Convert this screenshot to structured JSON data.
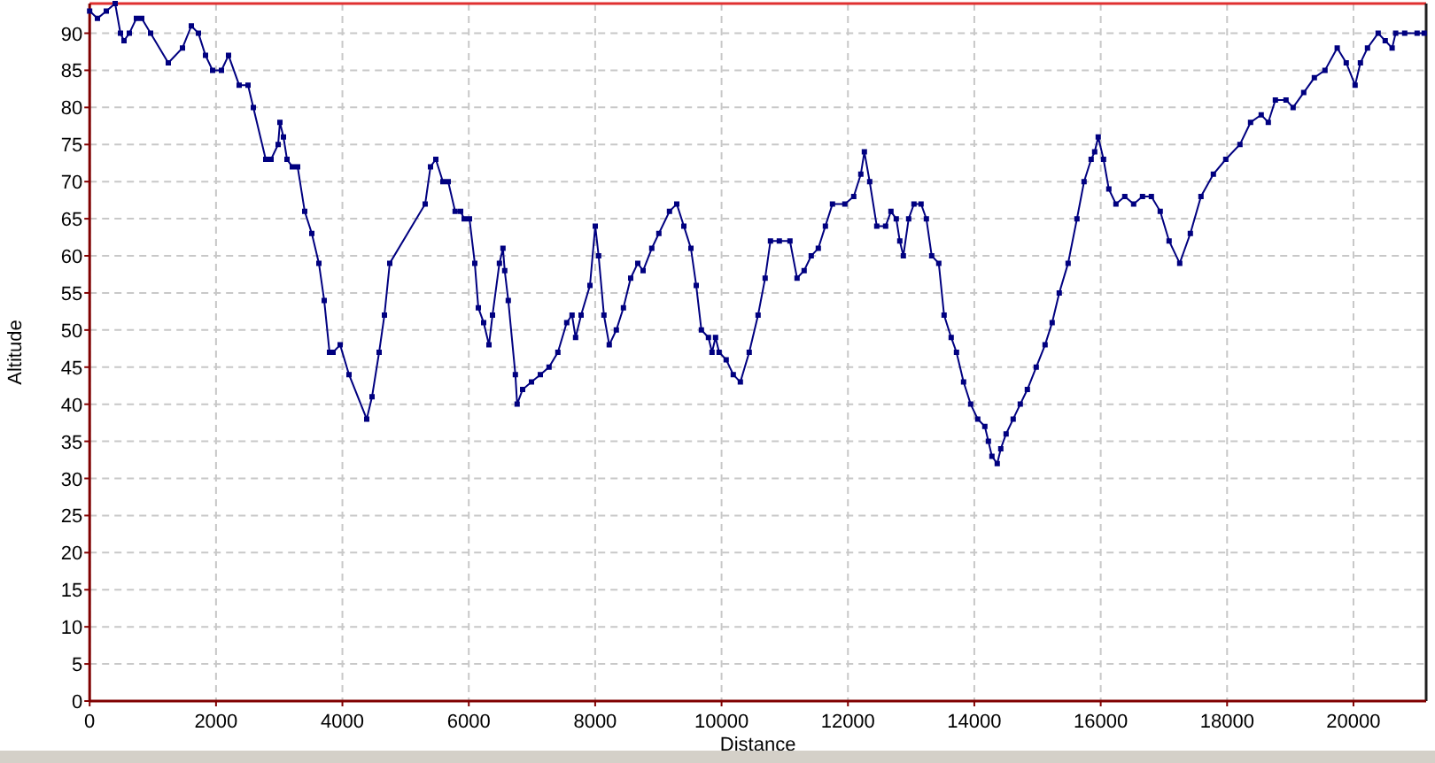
{
  "chart_data": {
    "type": "line",
    "xlabel": "Distance",
    "ylabel": "Altitude",
    "xlim": [
      0,
      21150
    ],
    "ylim": [
      0,
      94
    ],
    "grid": true,
    "xticks": [
      0,
      2000,
      4000,
      6000,
      8000,
      10000,
      12000,
      14000,
      16000,
      18000,
      20000
    ],
    "yticks": [
      0,
      5,
      10,
      15,
      20,
      25,
      30,
      35,
      40,
      45,
      50,
      55,
      60,
      65,
      70,
      75,
      80,
      85,
      90
    ],
    "x": [
      0,
      123,
      263,
      404,
      488,
      544,
      628,
      740,
      824,
      964,
      1245,
      1469,
      1609,
      1721,
      1833,
      1945,
      2085,
      2198,
      2366,
      2506,
      2590,
      2786,
      2870,
      2982,
      3010,
      3066,
      3123,
      3207,
      3291,
      3403,
      3515,
      3627,
      3711,
      3795,
      3851,
      3963,
      4104,
      4384,
      4468,
      4580,
      4664,
      4748,
      5309,
      5393,
      5477,
      5589,
      5673,
      5785,
      5870,
      5926,
      6010,
      6094,
      6150,
      6234,
      6318,
      6374,
      6486,
      6542,
      6570,
      6626,
      6738,
      6766,
      6851,
      6991,
      7131,
      7271,
      7411,
      7551,
      7635,
      7691,
      7776,
      7916,
      8000,
      8056,
      8140,
      8224,
      8336,
      8448,
      8561,
      8673,
      8757,
      8897,
      9009,
      9177,
      9290,
      9402,
      9514,
      9598,
      9682,
      9794,
      9850,
      9906,
      9962,
      10074,
      10186,
      10298,
      10438,
      10578,
      10691,
      10775,
      10915,
      11083,
      11195,
      11307,
      11419,
      11531,
      11644,
      11756,
      11952,
      12092,
      12204,
      12260,
      12345,
      12457,
      12597,
      12681,
      12765,
      12821,
      12877,
      12961,
      13045,
      13157,
      13241,
      13325,
      13437,
      13522,
      13634,
      13718,
      13830,
      13942,
      14054,
      14166,
      14222,
      14278,
      14362,
      14419,
      14503,
      14615,
      14727,
      14839,
      14979,
      15119,
      15231,
      15343,
      15484,
      15624,
      15736,
      15848,
      15904,
      15960,
      16044,
      16128,
      16240,
      16380,
      16521,
      16661,
      16801,
      16941,
      17082,
      17250,
      17418,
      17586,
      17782,
      17978,
      18203,
      18371,
      18539,
      18651,
      18763,
      18931,
      19044,
      19212,
      19380,
      19548,
      19744,
      19885,
      20025,
      20109,
      20221,
      20389,
      20501,
      20613,
      20669,
      20810,
      21006,
      21118
    ],
    "series": [
      {
        "color": "#000080",
        "values": [
          93,
          92,
          93,
          94,
          90,
          89,
          90,
          92,
          92,
          90,
          86,
          88,
          91,
          90,
          87,
          85,
          85,
          87,
          83,
          83,
          80,
          73,
          73,
          75,
          78,
          76,
          73,
          72,
          72,
          66,
          63,
          59,
          54,
          47,
          47,
          48,
          44,
          38,
          41,
          47,
          52,
          59,
          67,
          72,
          73,
          70,
          70,
          66,
          66,
          65,
          65,
          59,
          53,
          51,
          48,
          52,
          59,
          61,
          58,
          54,
          44,
          40,
          42,
          43,
          44,
          45,
          47,
          51,
          52,
          49,
          52,
          56,
          64,
          60,
          52,
          48,
          50,
          53,
          57,
          59,
          58,
          61,
          63,
          66,
          67,
          64,
          61,
          56,
          50,
          49,
          47,
          49,
          47,
          46,
          44,
          43,
          47,
          52,
          57,
          62,
          62,
          62,
          57,
          58,
          60,
          61,
          64,
          67,
          67,
          68,
          71,
          74,
          70,
          64,
          64,
          66,
          65,
          62,
          60,
          65,
          67,
          67,
          65,
          60,
          59,
          52,
          49,
          47,
          43,
          40,
          38,
          37,
          35,
          33,
          32,
          34,
          36,
          38,
          40,
          42,
          45,
          48,
          51,
          55,
          59,
          65,
          70,
          73,
          74,
          76,
          73,
          69,
          67,
          68,
          67,
          68,
          68,
          66,
          62,
          59,
          63,
          68,
          71,
          73,
          75,
          78,
          79,
          78,
          81,
          81,
          80,
          82,
          84,
          85,
          88,
          86,
          83,
          86,
          88,
          90,
          89,
          88,
          90,
          90,
          90,
          90
        ]
      }
    ]
  }
}
